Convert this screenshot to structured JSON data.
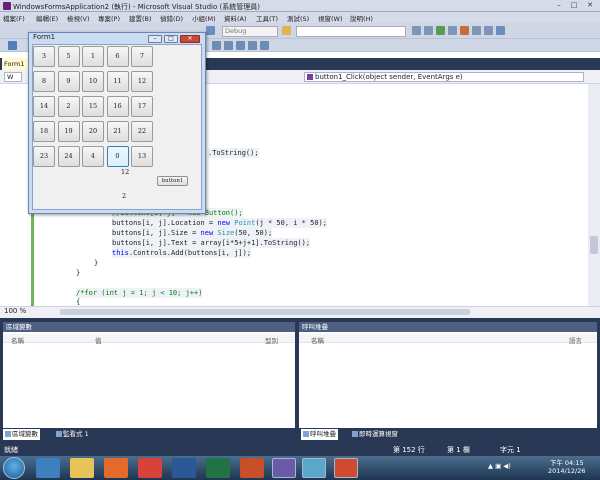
{
  "window": {
    "title": "WindowsFormsApplication2 (執行) - Microsoft Visual Studio (系統管理員)",
    "min": "–",
    "max": "□",
    "close": "✕"
  },
  "menu": [
    "檔案(F)",
    "編輯(E)",
    "檢視(V)",
    "專案(P)",
    "建置(B)",
    "偵錯(D)",
    "小組(M)",
    "資料(A)",
    "工具(T)",
    "測試(S)",
    "視窗(W)",
    "說明(H)"
  ],
  "toolbar": {
    "config": "Debug"
  },
  "tabs": {
    "active": "Form1"
  },
  "navbar": {
    "left": "W",
    "right": "button1_Click(object sender, EventArgs e)"
  },
  "code": {
    "line1": ".ToString();",
    "line2_prefix": "//buttons[i, j] = ",
    "line2_kw": "new",
    "line2_suffix": " Button();",
    "line3_a": "buttons[i, j].Location = ",
    "line3_kw": "new",
    "line3_ty": " Point",
    "line3_b": "(j * 50, i * 50);",
    "line4_a": "buttons[i, j].Size = ",
    "line4_kw": "new",
    "line4_ty": " Size",
    "line4_b": "(50, 50);",
    "line5": "buttons[i, j].Text = array[i*5+j+1].ToString();",
    "line6_kw": "this",
    "line6_b": ".Controls.Add(buttons[i, j]);",
    "line7": "}",
    "line8": "}",
    "line9": "/*for (int j = 1; j < 10; j++)",
    "line10": "{"
  },
  "zoom": "100 %",
  "form1": {
    "title": "Form1",
    "grid": [
      [
        "3",
        "5",
        "1",
        "6",
        "7"
      ],
      [
        "8",
        "9",
        "10",
        "11",
        "12"
      ],
      [
        "14",
        "2",
        "15",
        "16",
        "17"
      ],
      [
        "18",
        "19",
        "20",
        "21",
        "22"
      ],
      [
        "23",
        "24",
        "4",
        "0",
        "13"
      ]
    ],
    "label_top": "12",
    "label_bottom": "2",
    "button1": "button1"
  },
  "locals": {
    "title": "區域變數",
    "cols": [
      "名稱",
      "值",
      "型別"
    ],
    "tabs": [
      "區域變數",
      "監看式 1"
    ]
  },
  "callstack": {
    "title": "呼叫堆疊",
    "cols": [
      "名稱",
      "語言"
    ],
    "tabs": [
      "呼叫堆疊",
      "即時運算視窗"
    ]
  },
  "status": {
    "ready": "就緒",
    "line": "第 152 行",
    "col": "第 1 欄",
    "ch": "字元 1"
  },
  "taskbar": {
    "time": "下午 04:15",
    "date": "2014/12/26",
    "tray": "▲ ▣ ◀)"
  }
}
